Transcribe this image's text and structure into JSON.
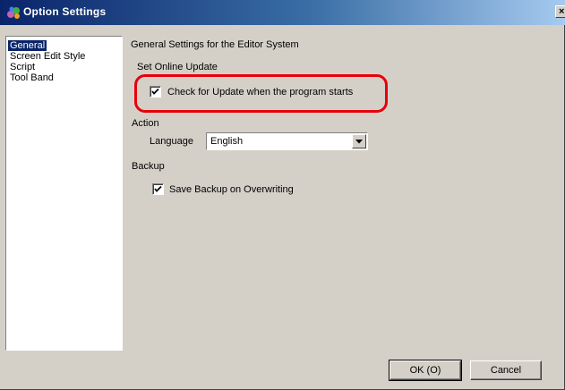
{
  "window": {
    "title": "Option Settings",
    "close_glyph": "×"
  },
  "sidebar": {
    "items": [
      {
        "label": "General",
        "selected": true
      },
      {
        "label": "Screen Edit Style",
        "selected": false
      },
      {
        "label": "Script",
        "selected": false
      },
      {
        "label": "Tool Band",
        "selected": false
      }
    ]
  },
  "main": {
    "heading": "General Settings for the Editor System",
    "online_update": {
      "group_label": "Set Online Update",
      "check_update_label": "Check for Update when the program starts",
      "check_update_checked": true
    },
    "action": {
      "group_label": "Action",
      "language_label": "Language",
      "language_value": "English"
    },
    "backup": {
      "group_label": "Backup",
      "save_backup_label": "Save Backup on Overwriting",
      "save_backup_checked": true
    }
  },
  "footer": {
    "ok_label": "OK (O)",
    "cancel_label": "Cancel"
  },
  "colors": {
    "highlight": "#e8000b",
    "title_gradient_start": "#0a246a",
    "title_gradient_end": "#a6caf0",
    "selected_bg": "#0a246a"
  },
  "icons": {
    "title": "app-settings-icon",
    "check": "checkmark-icon",
    "dropdown": "dropdown-arrow-icon"
  }
}
